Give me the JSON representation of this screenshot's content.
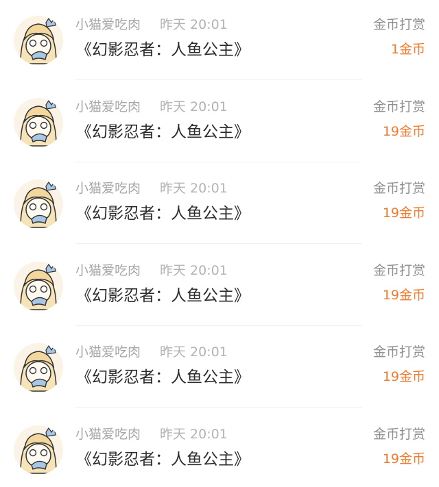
{
  "records": [
    {
      "user": "小猫爱吃肉",
      "time": "昨天 20:01",
      "book": "《幻影忍者：人鱼公主》",
      "type": "金币打赏",
      "amount": "1金币"
    },
    {
      "user": "小猫爱吃肉",
      "time": "昨天 20:01",
      "book": "《幻影忍者：人鱼公主》",
      "type": "金币打赏",
      "amount": "19金币"
    },
    {
      "user": "小猫爱吃肉",
      "time": "昨天 20:01",
      "book": "《幻影忍者：人鱼公主》",
      "type": "金币打赏",
      "amount": "19金币"
    },
    {
      "user": "小猫爱吃肉",
      "time": "昨天 20:01",
      "book": "《幻影忍者：人鱼公主》",
      "type": "金币打赏",
      "amount": "19金币"
    },
    {
      "user": "小猫爱吃肉",
      "time": "昨天 20:01",
      "book": "《幻影忍者：人鱼公主》",
      "type": "金币打赏",
      "amount": "19金币"
    },
    {
      "user": "小猫爱吃肉",
      "time": "昨天 20:01",
      "book": "《幻影忍者：人鱼公主》",
      "type": "金币打赏",
      "amount": "19金币"
    }
  ],
  "colors": {
    "amount": "#f07b2e",
    "name": "#a7a7a7",
    "title": "#2c2c2c"
  },
  "avatar_icon": "anime-girl-holding-cat-avatar"
}
